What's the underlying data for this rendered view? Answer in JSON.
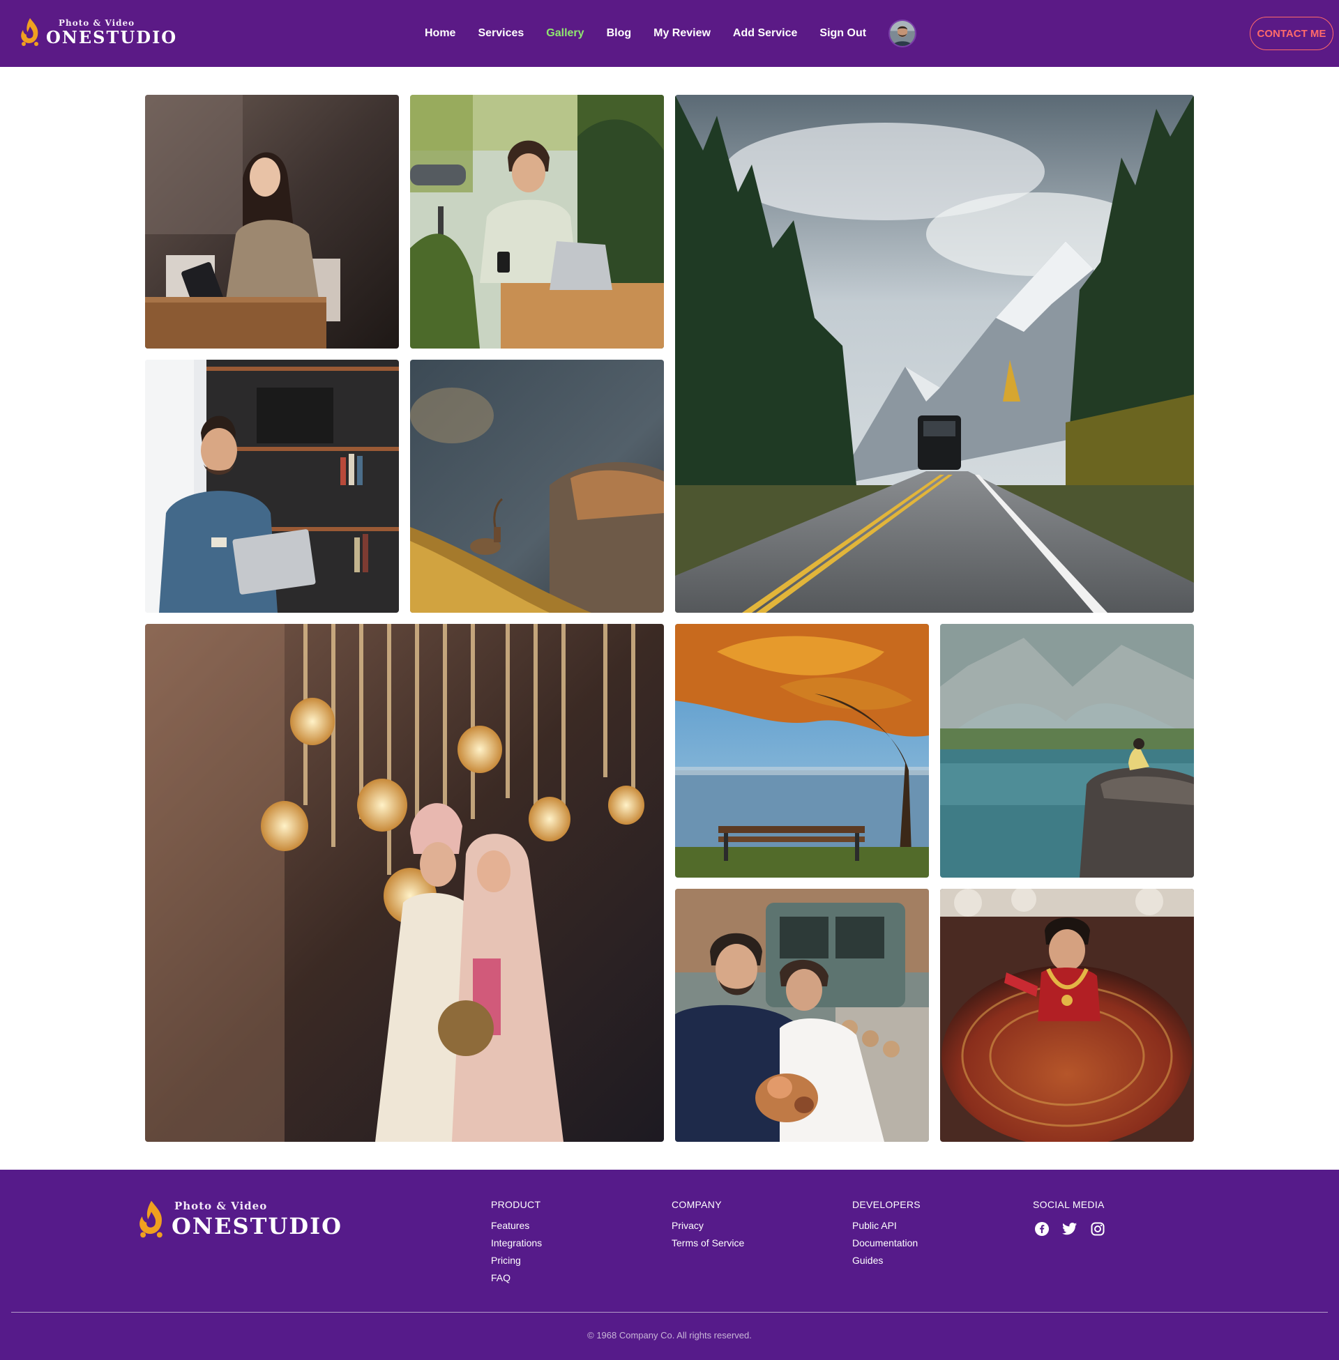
{
  "brand": {
    "tagline": "Photo & Video",
    "name": "ONESTUDIO"
  },
  "nav": [
    {
      "label": "Home",
      "active": false
    },
    {
      "label": "Services",
      "active": false
    },
    {
      "label": "Gallery",
      "active": true
    },
    {
      "label": "Blog",
      "active": false
    },
    {
      "label": "My Review",
      "active": false
    },
    {
      "label": "Add Service",
      "active": false
    },
    {
      "label": "Sign Out",
      "active": false
    }
  ],
  "contact_label": "CONTACT ME",
  "gallery": [
    {
      "name": "photo-woman-tablet",
      "icon": "photo"
    },
    {
      "name": "photo-man-laptop-outdoor",
      "icon": "photo"
    },
    {
      "name": "photo-mountain-road",
      "icon": "photo"
    },
    {
      "name": "photo-man-credit-card",
      "icon": "photo"
    },
    {
      "name": "photo-ibex",
      "icon": "photo"
    },
    {
      "name": "photo-wedding-couple-lights",
      "icon": "photo"
    },
    {
      "name": "photo-autumn-tree-bench",
      "icon": "photo"
    },
    {
      "name": "photo-lake-girl-rock",
      "icon": "photo"
    },
    {
      "name": "photo-couple-vintage-car",
      "icon": "photo"
    },
    {
      "name": "photo-bride-red-lehenga",
      "icon": "photo"
    }
  ],
  "footer": {
    "columns": [
      {
        "title": "PRODUCT",
        "links": [
          "Features",
          "Integrations",
          "Pricing",
          "FAQ"
        ]
      },
      {
        "title": "COMPANY",
        "links": [
          "Privacy",
          "Terms of Service"
        ]
      },
      {
        "title": "DEVELOPERS",
        "links": [
          "Public API",
          "Documentation",
          "Guides"
        ]
      }
    ],
    "social_title": "SOCIAL MEDIA",
    "social": [
      "facebook-icon",
      "twitter-icon",
      "instagram-icon"
    ],
    "copyright": "© 1968 Company Co. All rights reserved."
  },
  "colors": {
    "header_bg": "#5b1a86",
    "footer_bg": "#561b8a",
    "active_nav": "#8fe66f",
    "contact": "#ff6a6a",
    "logo_flame": "#f0a020"
  }
}
